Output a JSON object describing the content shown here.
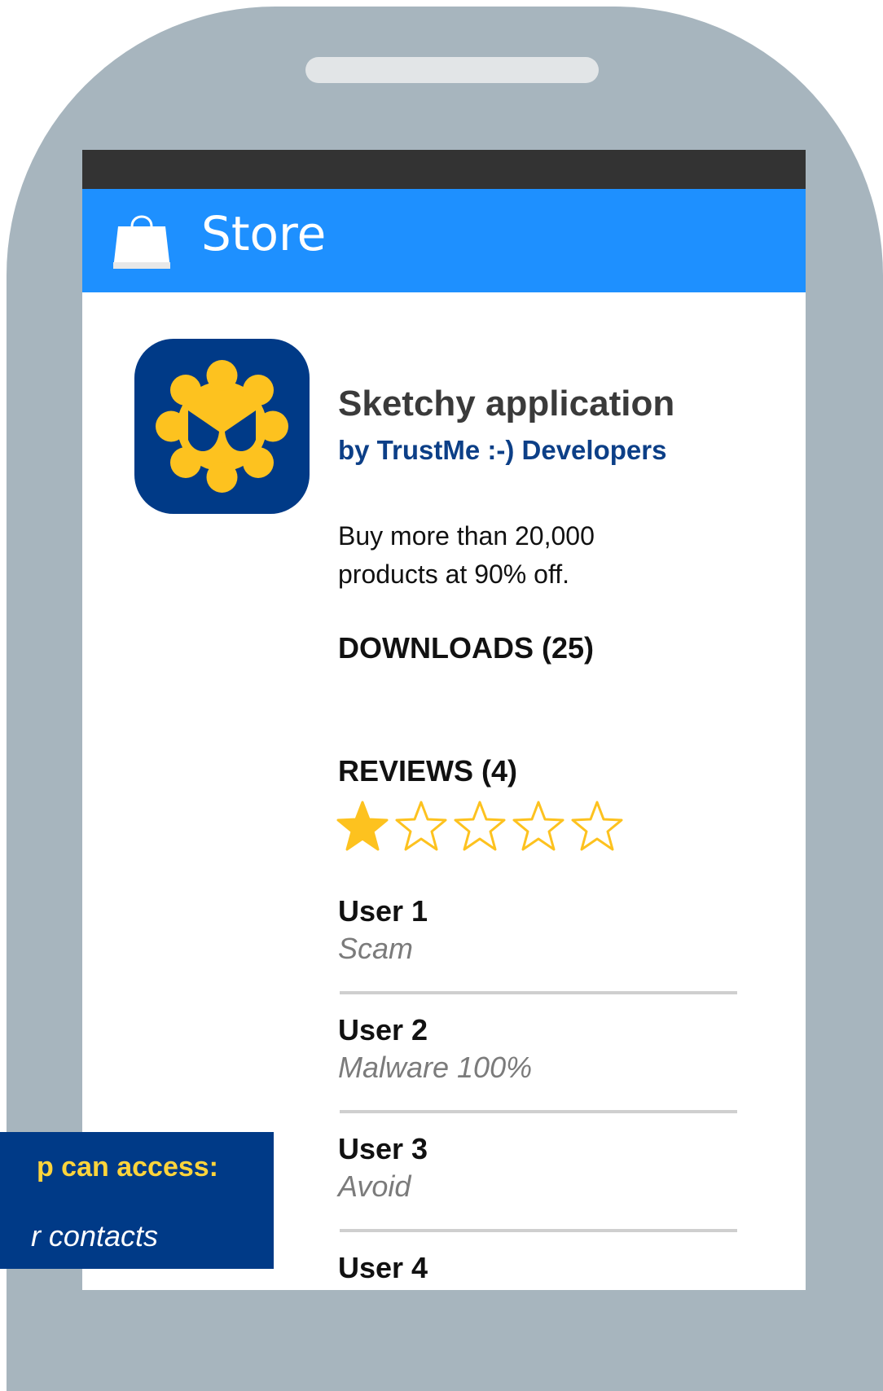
{
  "store": {
    "title": "Store",
    "icon": "shopping-bag-icon"
  },
  "app": {
    "name": "Sketchy application",
    "developer": "by TrustMe :-) Developers",
    "description": "Buy more than 20,000 products at 90% off.",
    "downloads": "DOWNLOADS (25)",
    "icon": "malware-bug-icon"
  },
  "reviews": {
    "heading": "REVIEWS (4)",
    "rating": 1,
    "max_rating": 5,
    "items": [
      {
        "user": "User 1",
        "text": "Scam"
      },
      {
        "user": "User 2",
        "text": "Malware 100%"
      },
      {
        "user": "User 3",
        "text": "Avoid"
      },
      {
        "user": "User 4",
        "text": ""
      }
    ]
  },
  "permissions_panel": {
    "title": "p can access:",
    "items": [
      "r contacts"
    ]
  },
  "colors": {
    "phone_frame": "#a7b5be",
    "status_bar": "#333333",
    "app_bar": "#1e90ff",
    "app_icon_bg": "#003a87",
    "developer_text": "#0c3f87",
    "star": "#fdc21f",
    "overlay_bg": "#003a87",
    "overlay_title": "#ffd43b"
  }
}
